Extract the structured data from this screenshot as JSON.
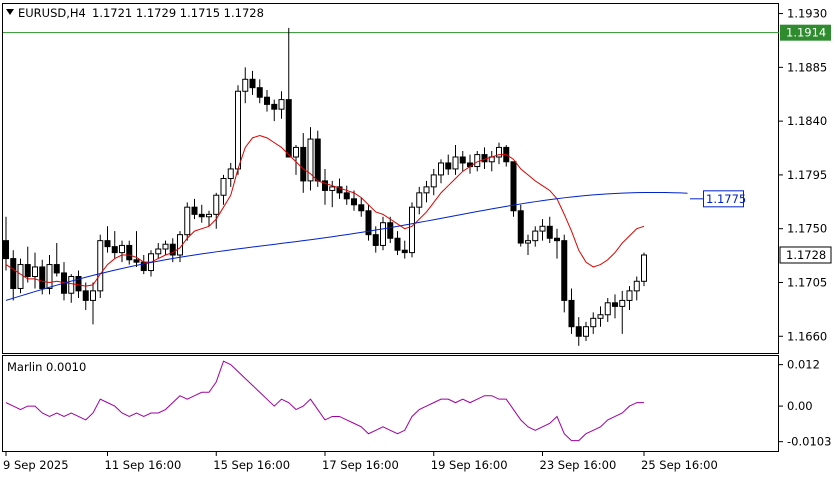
{
  "header": {
    "symbol": "EURUSD,H4",
    "ohlc": "1.1721 1.1729 1.1715 1.1728"
  },
  "colors": {
    "bull_body": "#ffffff",
    "bear_body": "#000000",
    "ma_fast": "#e00000",
    "ma_slow": "#0022cc",
    "level_line": "#2e8b2e",
    "oscillator": "#a000a0",
    "grid": "#c8c8c8"
  },
  "chart_data": {
    "type": "candlestick",
    "price_axis": {
      "ticks": [
        1.193,
        1.1885,
        1.184,
        1.1795,
        1.175,
        1.1705,
        1.166
      ],
      "tick_labels": [
        "1.1930",
        "1.1885",
        "1.1840",
        "1.1795",
        "1.1750",
        "1.1705",
        "1.1660"
      ],
      "range": [
        1.1646,
        1.1938
      ]
    },
    "time_axis": {
      "labels": [
        "9 Sep 2025",
        "11 Sep 16:00",
        "15 Sep 16:00",
        "17 Sep 16:00",
        "19 Sep 16:00",
        "23 Sep 16:00",
        "25 Sep 16:00"
      ],
      "label_bar_index": [
        0,
        14,
        29,
        44,
        59,
        74,
        88
      ]
    },
    "levels": [
      {
        "value": 1.1914,
        "label": "1.1914",
        "style": "solid-line",
        "color": "#2e8b2e"
      },
      {
        "value": 1.1775,
        "label": "1.1775",
        "style": "box-with-tick",
        "color": "#0022cc"
      },
      {
        "value": 1.1728,
        "label": "1.1728",
        "style": "current-price"
      }
    ],
    "candles": [
      [
        1.174,
        1.176,
        1.1715,
        1.1725
      ],
      [
        1.1725,
        1.1732,
        1.169,
        1.17
      ],
      [
        1.17,
        1.1725,
        1.1696,
        1.172
      ],
      [
        1.172,
        1.1735,
        1.1705,
        1.171
      ],
      [
        1.171,
        1.173,
        1.17,
        1.1718
      ],
      [
        1.1718,
        1.1724,
        1.1695,
        1.17
      ],
      [
        1.17,
        1.1728,
        1.1695,
        1.172
      ],
      [
        1.172,
        1.1738,
        1.171,
        1.1713
      ],
      [
        1.1713,
        1.1722,
        1.169,
        1.1696
      ],
      [
        1.1696,
        1.1712,
        1.1688,
        1.171
      ],
      [
        1.171,
        1.1715,
        1.1692,
        1.1698
      ],
      [
        1.1698,
        1.1705,
        1.1682,
        1.169
      ],
      [
        1.169,
        1.1705,
        1.167,
        1.1698
      ],
      [
        1.1698,
        1.1745,
        1.1692,
        1.174
      ],
      [
        1.174,
        1.1752,
        1.173,
        1.1735
      ],
      [
        1.1735,
        1.1748,
        1.1725,
        1.173
      ],
      [
        1.173,
        1.174,
        1.1722,
        1.1736
      ],
      [
        1.1736,
        1.174,
        1.172,
        1.1724
      ],
      [
        1.1724,
        1.1748,
        1.1718,
        1.1722
      ],
      [
        1.1722,
        1.1728,
        1.1712,
        1.1715
      ],
      [
        1.1715,
        1.1732,
        1.171,
        1.1729
      ],
      [
        1.1729,
        1.1738,
        1.1725,
        1.1733
      ],
      [
        1.1733,
        1.174,
        1.1728,
        1.1737
      ],
      [
        1.1737,
        1.1742,
        1.1722,
        1.1728
      ],
      [
        1.1728,
        1.1748,
        1.1722,
        1.1745
      ],
      [
        1.1745,
        1.1772,
        1.174,
        1.1768
      ],
      [
        1.1768,
        1.1775,
        1.1758,
        1.1762
      ],
      [
        1.1762,
        1.177,
        1.1755,
        1.176
      ],
      [
        1.176,
        1.1765,
        1.1752,
        1.1762
      ],
      [
        1.1762,
        1.178,
        1.175,
        1.1778
      ],
      [
        1.1778,
        1.1795,
        1.177,
        1.1792
      ],
      [
        1.1792,
        1.1805,
        1.1785,
        1.18
      ],
      [
        1.18,
        1.187,
        1.1795,
        1.1865
      ],
      [
        1.1865,
        1.1885,
        1.1855,
        1.1875
      ],
      [
        1.1875,
        1.1882,
        1.1862,
        1.1868
      ],
      [
        1.1868,
        1.1875,
        1.1855,
        1.186
      ],
      [
        1.186,
        1.1866,
        1.1848,
        1.1854
      ],
      [
        1.1854,
        1.1858,
        1.184,
        1.185
      ],
      [
        1.185,
        1.1865,
        1.1842,
        1.1858
      ],
      [
        1.1858,
        1.1918,
        1.1818,
        1.181
      ],
      [
        1.181,
        1.182,
        1.1795,
        1.1818
      ],
      [
        1.1818,
        1.183,
        1.178,
        1.179
      ],
      [
        1.179,
        1.1835,
        1.1782,
        1.1825
      ],
      [
        1.1825,
        1.1832,
        1.1785,
        1.179
      ],
      [
        1.179,
        1.18,
        1.177,
        1.1782
      ],
      [
        1.1782,
        1.179,
        1.1768,
        1.1785
      ],
      [
        1.1785,
        1.1792,
        1.1775,
        1.178
      ],
      [
        1.178,
        1.1786,
        1.177,
        1.1775
      ],
      [
        1.1775,
        1.1782,
        1.1765,
        1.177
      ],
      [
        1.177,
        1.1776,
        1.176,
        1.1765
      ],
      [
        1.1765,
        1.177,
        1.174,
        1.1745
      ],
      [
        1.1745,
        1.1752,
        1.173,
        1.1736
      ],
      [
        1.1736,
        1.176,
        1.1732,
        1.1755
      ],
      [
        1.1755,
        1.176,
        1.1738,
        1.1742
      ],
      [
        1.1742,
        1.1748,
        1.1728,
        1.1732
      ],
      [
        1.1732,
        1.174,
        1.1725,
        1.173
      ],
      [
        1.173,
        1.1772,
        1.1726,
        1.1768
      ],
      [
        1.1768,
        1.1785,
        1.1762,
        1.178
      ],
      [
        1.178,
        1.179,
        1.1772,
        1.1785
      ],
      [
        1.1785,
        1.18,
        1.1778,
        1.1795
      ],
      [
        1.1795,
        1.1808,
        1.1788,
        1.1805
      ],
      [
        1.1805,
        1.1812,
        1.1795,
        1.18
      ],
      [
        1.18,
        1.182,
        1.1795,
        1.181
      ],
      [
        1.181,
        1.1815,
        1.1798,
        1.1805
      ],
      [
        1.1805,
        1.1812,
        1.1796,
        1.1802
      ],
      [
        1.1802,
        1.1815,
        1.1798,
        1.1812
      ],
      [
        1.1812,
        1.1818,
        1.18,
        1.1806
      ],
      [
        1.1806,
        1.1815,
        1.1798,
        1.181
      ],
      [
        1.181,
        1.1822,
        1.1804,
        1.1818
      ],
      [
        1.1818,
        1.182,
        1.1802,
        1.1806
      ],
      [
        1.1806,
        1.178,
        1.176,
        1.1765
      ],
      [
        1.1765,
        1.177,
        1.1735,
        1.1738
      ],
      [
        1.1738,
        1.1745,
        1.1728,
        1.174
      ],
      [
        1.174,
        1.1752,
        1.1735,
        1.1748
      ],
      [
        1.1748,
        1.1758,
        1.174,
        1.1752
      ],
      [
        1.1752,
        1.176,
        1.1738,
        1.1742
      ],
      [
        1.1742,
        1.175,
        1.1725,
        1.174
      ],
      [
        1.174,
        1.1745,
        1.168,
        1.169
      ],
      [
        1.169,
        1.17,
        1.1662,
        1.1668
      ],
      [
        1.1668,
        1.1676,
        1.1652,
        1.166
      ],
      [
        1.166,
        1.1672,
        1.1656,
        1.1668
      ],
      [
        1.1668,
        1.168,
        1.1662,
        1.1675
      ],
      [
        1.1675,
        1.1685,
        1.1668,
        1.1678
      ],
      [
        1.1678,
        1.1692,
        1.1672,
        1.1688
      ],
      [
        1.1688,
        1.1695,
        1.1675,
        1.1685
      ],
      [
        1.1685,
        1.1698,
        1.1662,
        1.169
      ],
      [
        1.169,
        1.1702,
        1.1682,
        1.1698
      ],
      [
        1.1698,
        1.171,
        1.169,
        1.1706
      ],
      [
        1.1706,
        1.173,
        1.1702,
        1.1728
      ]
    ],
    "ma_fast": {
      "color": "#e00000",
      "values": [
        1.172,
        1.1716,
        1.1712,
        1.1708,
        1.1708,
        1.1706,
        1.1705,
        1.1706,
        1.1705,
        1.1704,
        1.1703,
        1.1702,
        1.1703,
        1.1712,
        1.172,
        1.1725,
        1.1728,
        1.1728,
        1.1726,
        1.1722,
        1.1722,
        1.1725,
        1.1728,
        1.173,
        1.1734,
        1.1742,
        1.1748,
        1.175,
        1.1752,
        1.1758,
        1.1768,
        1.1778,
        1.18,
        1.1818,
        1.1826,
        1.1828,
        1.1826,
        1.1822,
        1.1818,
        1.1812,
        1.1806,
        1.18,
        1.1796,
        1.179,
        1.1788,
        1.1786,
        1.1784,
        1.1782,
        1.178,
        1.1776,
        1.177,
        1.1764,
        1.1762,
        1.1758,
        1.1754,
        1.175,
        1.1752,
        1.1758,
        1.1764,
        1.1772,
        1.178,
        1.1786,
        1.1792,
        1.1798,
        1.1802,
        1.1806,
        1.1808,
        1.181,
        1.1812,
        1.1812,
        1.1808,
        1.18,
        1.1795,
        1.179,
        1.1786,
        1.1782,
        1.1775,
        1.1762,
        1.1748,
        1.1732,
        1.1722,
        1.1718,
        1.172,
        1.1724,
        1.173,
        1.1738,
        1.1744,
        1.175,
        1.1752
      ]
    },
    "ma_slow": {
      "color": "#0022cc",
      "end_value": 1.1778
    },
    "oscillator": {
      "name": "Marlin 0.0010",
      "color": "#a000a0",
      "ticks": [
        0.012,
        0.0,
        -0.0103
      ],
      "tick_labels": [
        "0.012",
        "0.00",
        "-0.0103"
      ],
      "range": [
        -0.013,
        0.0145
      ],
      "values": [
        0.001,
        0.0,
        -0.001,
        0.0,
        0.0,
        -0.002,
        -0.003,
        -0.002,
        -0.003,
        -0.002,
        -0.003,
        -0.004,
        -0.002,
        0.002,
        0.001,
        0.0,
        -0.002,
        -0.003,
        -0.002,
        -0.003,
        -0.002,
        -0.002,
        -0.001,
        0.001,
        0.003,
        0.002,
        0.003,
        0.004,
        0.004,
        0.007,
        0.013,
        0.012,
        0.01,
        0.008,
        0.006,
        0.004,
        0.002,
        0.0,
        0.002,
        0.001,
        -0.001,
        0.0,
        0.002,
        -0.001,
        -0.004,
        -0.003,
        -0.003,
        -0.004,
        -0.005,
        -0.006,
        -0.008,
        -0.007,
        -0.006,
        -0.007,
        -0.008,
        -0.007,
        -0.003,
        -0.001,
        0.0,
        0.001,
        0.002,
        0.002,
        0.001,
        0.002,
        0.001,
        0.002,
        0.003,
        0.003,
        0.002,
        0.002,
        -0.001,
        -0.004,
        -0.006,
        -0.007,
        -0.006,
        -0.005,
        -0.003,
        -0.008,
        -0.01,
        -0.01,
        -0.008,
        -0.007,
        -0.006,
        -0.004,
        -0.003,
        -0.002,
        0.0,
        0.001,
        0.001
      ]
    }
  }
}
